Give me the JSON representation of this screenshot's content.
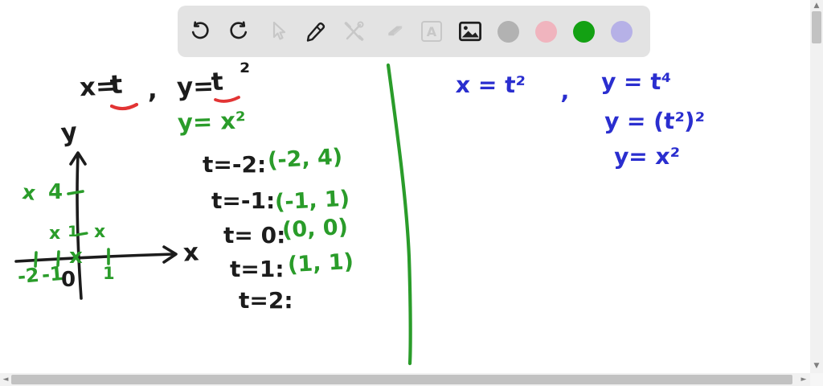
{
  "toolbar": {
    "tools": [
      {
        "id": "undo",
        "enabled": true
      },
      {
        "id": "redo",
        "enabled": true
      },
      {
        "id": "select",
        "enabled": false
      },
      {
        "id": "pen",
        "enabled": true
      },
      {
        "id": "shapes",
        "enabled": false
      },
      {
        "id": "eraser",
        "enabled": false
      },
      {
        "id": "text",
        "label": "A",
        "enabled": false
      },
      {
        "id": "image",
        "enabled": true
      }
    ],
    "colors": [
      {
        "id": "gray",
        "hex": "#b2b2b2"
      },
      {
        "id": "pink",
        "hex": "#f0b4be"
      },
      {
        "id": "green",
        "hex": "#13a113"
      },
      {
        "id": "purple",
        "hex": "#b6b1e7"
      }
    ]
  },
  "ink_colors": {
    "black": "#1c1c1c",
    "red": "#e23434",
    "green": "#2a9c2a",
    "blue": "#2a2ecf"
  },
  "board": {
    "left": {
      "equation": {
        "lhs": "x=",
        "t1": "t",
        "comma": ",",
        "rhs": "y=",
        "t2": "t",
        "sup": "²"
      },
      "derived": "y= x²",
      "axes": {
        "y_label": "y",
        "x_label": "x"
      },
      "y_tick_4": "4",
      "y_tick_1": "1",
      "x_tick_neg2": "-2",
      "x_tick_neg1": "-1",
      "x_tick_1": "1",
      "origin_label": "0",
      "mark_glyph": "x",
      "plotted_points": [
        [
          -2,
          4
        ],
        [
          -1,
          1
        ],
        [
          0,
          0
        ],
        [
          1,
          1
        ]
      ],
      "table": [
        {
          "t": "t=-2:",
          "point": "(-2, 4)"
        },
        {
          "t": "t=-1:",
          "point": "(-1, 1)"
        },
        {
          "t": "t= 0:",
          "point": "(0, 0)"
        },
        {
          "t": "t=1:",
          "point": "(1, 1)"
        },
        {
          "t": "t=2:",
          "point": ""
        }
      ]
    },
    "right": {
      "eq_x": "x = t²",
      "comma": ",",
      "eq_y": "y = t⁴",
      "step2": "y = (t²)²",
      "step3": "y= x²"
    }
  },
  "scrollbars": {
    "up": "▲",
    "down": "▼",
    "left": "◄",
    "right": "►"
  }
}
